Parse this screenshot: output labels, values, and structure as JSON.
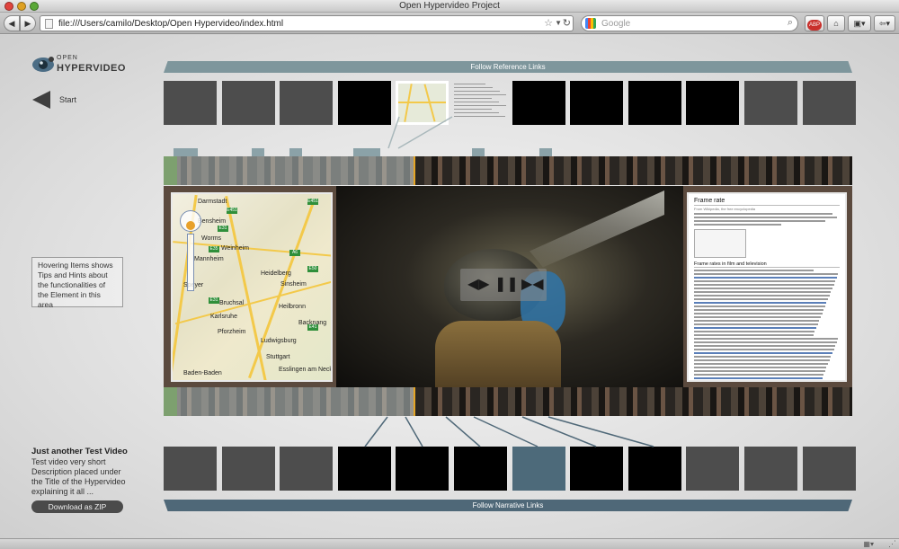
{
  "window": {
    "title": "Open Hypervideo Project",
    "url": "file:///Users/camilo/Desktop/Open Hypervideo/index.html",
    "search_placeholder": "Google",
    "abp_label": "ABP"
  },
  "sidebar": {
    "logo_open": "OPEN",
    "logo_hyper": "HYPERVIDEO",
    "start_label": "Start",
    "hint_text": "Hovering Items shows Tips and Hints about the functionalities of the Element in this area",
    "video_title": "Just another Test Video",
    "video_description": "Test video very short Description placed under the Title of the Hypervideo explaining it all ...",
    "download_label": "Download as ZIP"
  },
  "banners": {
    "reference": "Follow Reference Links",
    "narrative": "Follow Narrative Links"
  },
  "reference_links": [
    "gray",
    "gray",
    "gray",
    "black",
    "map",
    "document",
    "black",
    "black",
    "black",
    "black",
    "gray",
    "gray"
  ],
  "narrative_links": [
    "gray",
    "gray",
    "gray",
    "black",
    "black",
    "black",
    "blue",
    "black",
    "black",
    "gray",
    "gray",
    "gray"
  ],
  "map": {
    "cities": [
      "Darmstadt",
      "Bensheim",
      "Worms",
      "Weinheim",
      "Mannheim",
      "Heidelberg",
      "Speyer",
      "Sinsheim",
      "Bruchsal",
      "Heilbronn",
      "Karlsruhe",
      "Pforzheim",
      "Ludwigsburg",
      "Stuttgart",
      "Baden-Baden",
      "Esslingen am Neckar",
      "Backnang"
    ],
    "highways": [
      "E451",
      "E451",
      "E31",
      "E35",
      "E50",
      "A6",
      "E41",
      "E31"
    ]
  },
  "document": {
    "title": "Frame rate",
    "subtitle": "From Wikipedia, the free encyclopedia",
    "section": "Frame rates in film and television"
  },
  "controls": {
    "rewind": "◀▶",
    "pause": "❚❚",
    "forward": "▶◀"
  },
  "colors": {
    "reference_banner": "#7e969c",
    "narrative_banner": "#4f6878",
    "player_frame": "#5b4a3e",
    "timeline_marker": "#e5a524",
    "active_narrative": "#4d6a7a"
  }
}
